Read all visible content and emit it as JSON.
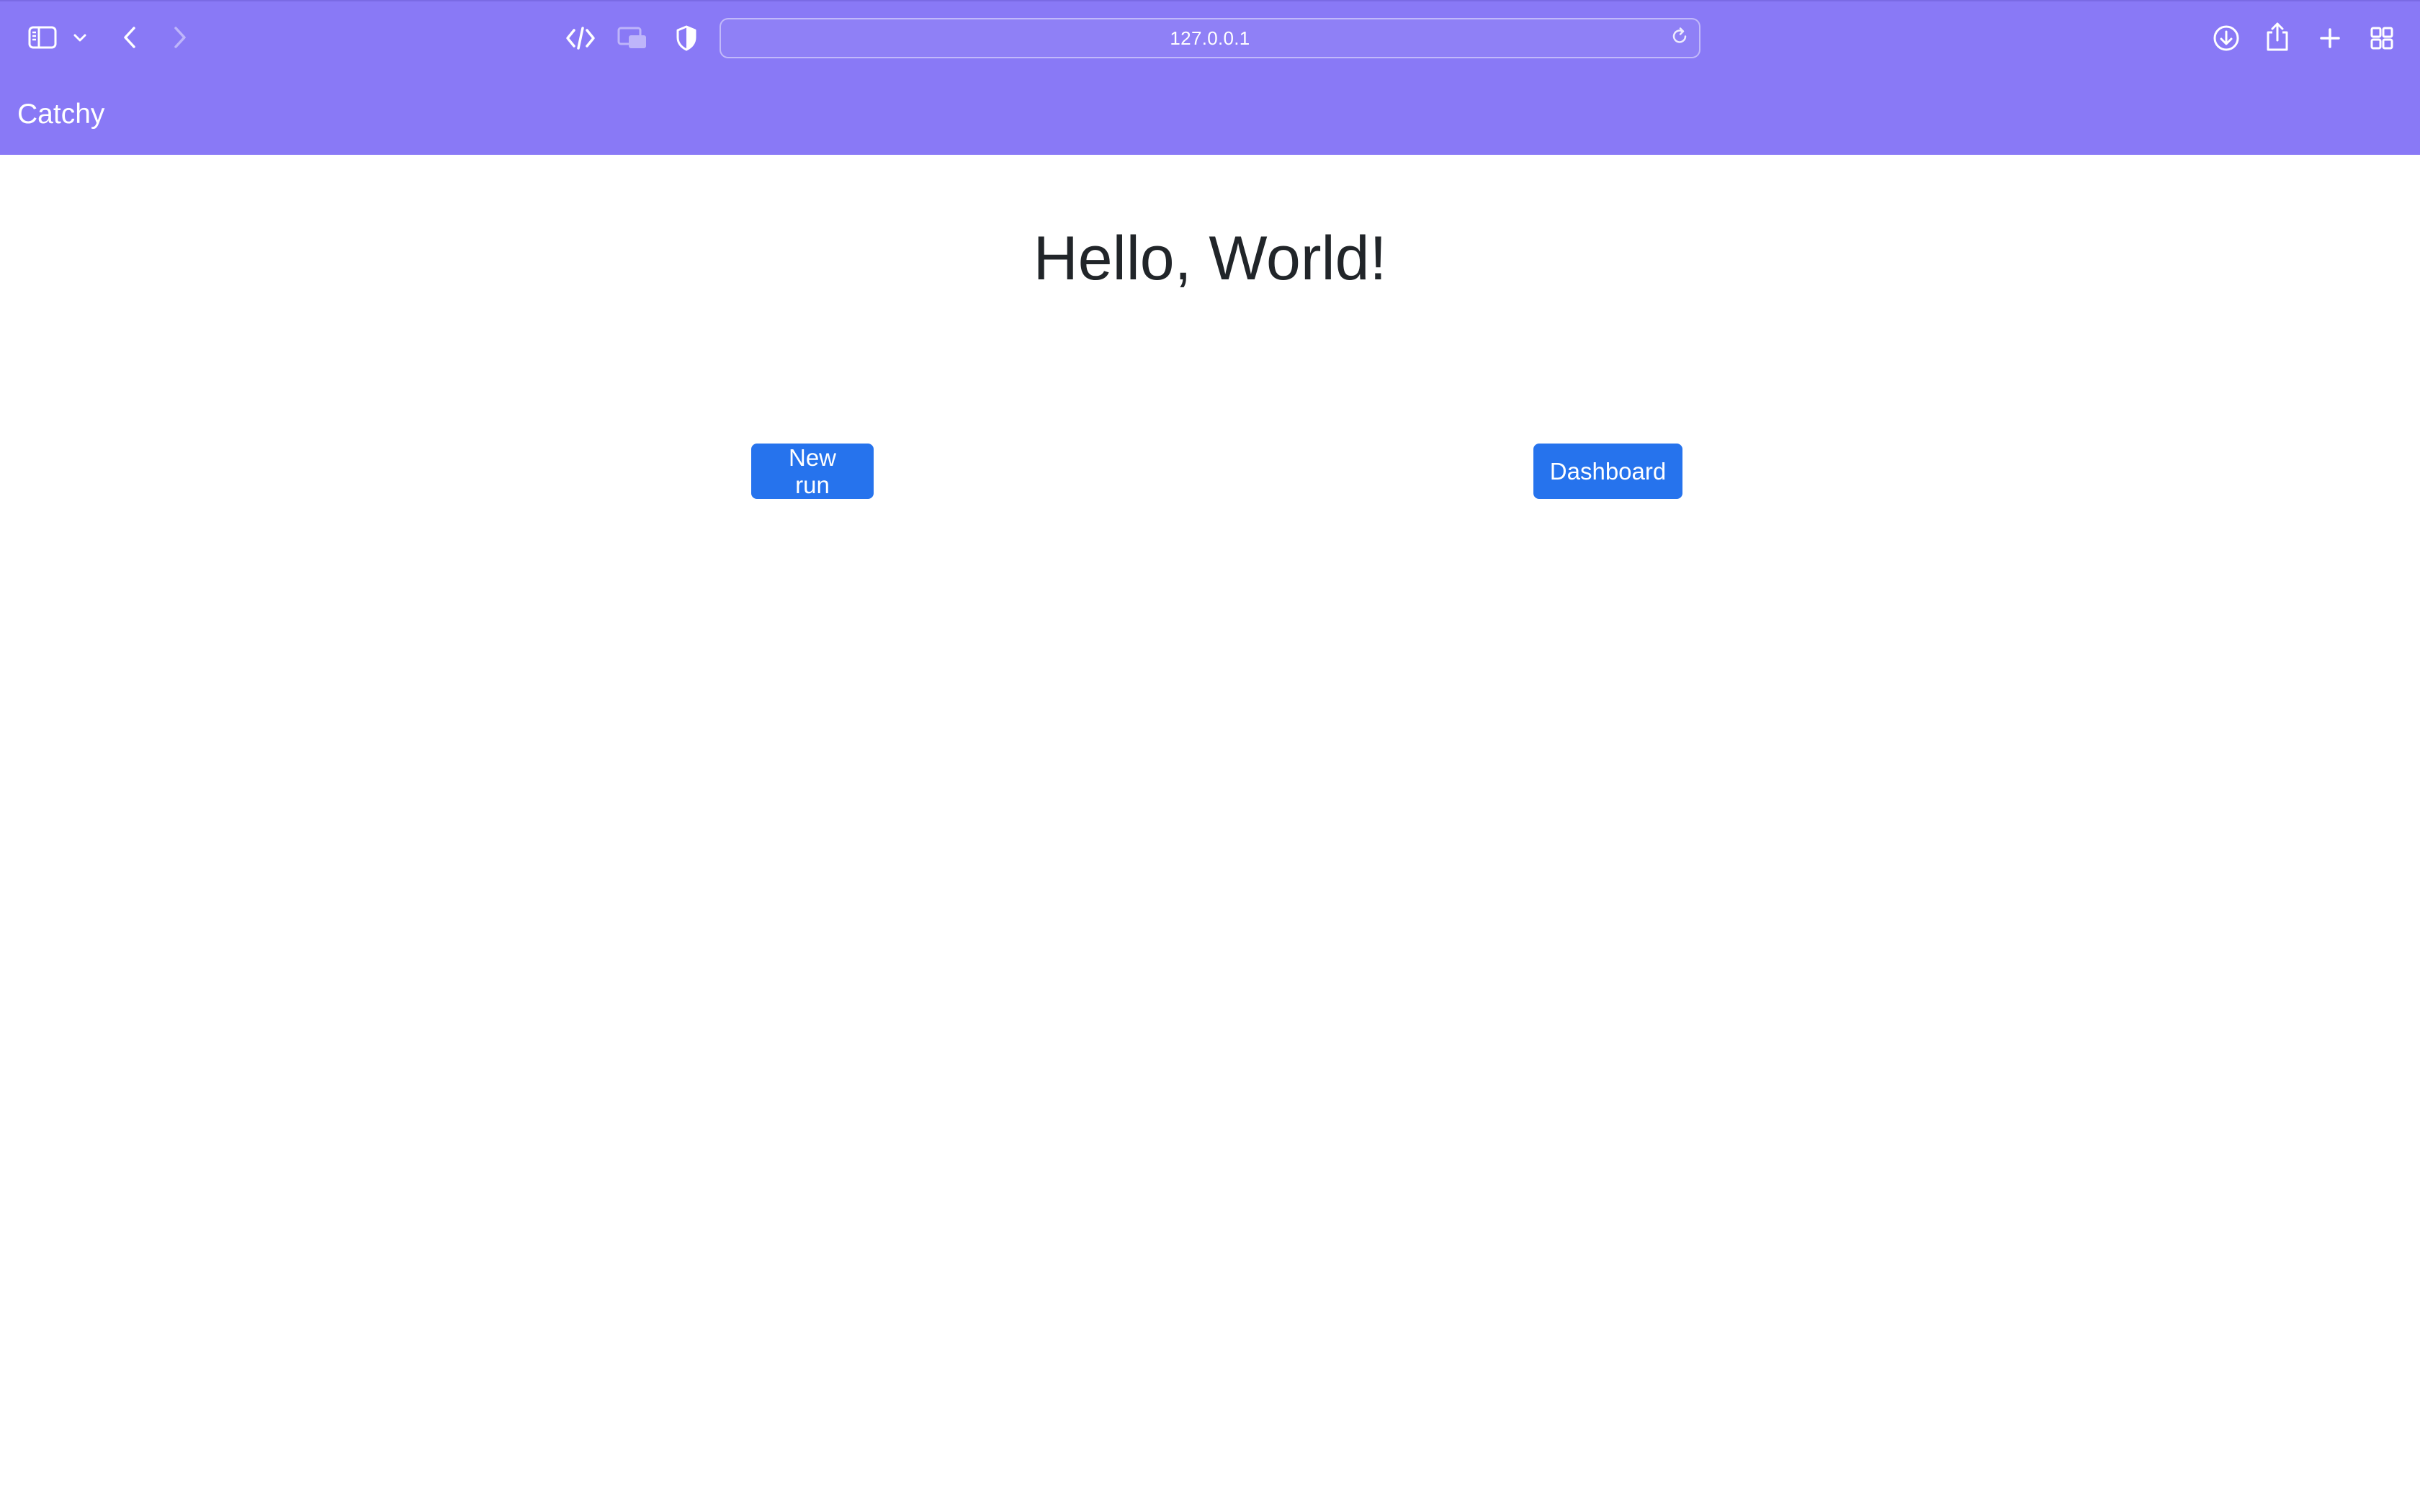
{
  "browser": {
    "url": "127.0.0.1",
    "icons": {
      "sidebar": "sidebar-icon",
      "sidebar_menu": "chevron-down-icon",
      "back": "chevron-left-icon",
      "forward": "chevron-right-icon",
      "dev_tools": "code-icon",
      "tab_overview": "picture-in-picture-icon",
      "privacy": "shield-icon",
      "reload": "reload-icon",
      "downloads": "download-icon",
      "share": "share-icon",
      "new_tab": "plus-icon",
      "tabs_grid": "grid-icon"
    }
  },
  "navbar": {
    "brand": "Catchy"
  },
  "main": {
    "title": "Hello, World!",
    "buttons": {
      "new_run": "New run",
      "dashboard": "Dashboard"
    }
  },
  "colors": {
    "navbar_bg": "#8979f6",
    "button_bg": "#2673ed",
    "text": "#212529",
    "page_bg": "#ffffff"
  }
}
